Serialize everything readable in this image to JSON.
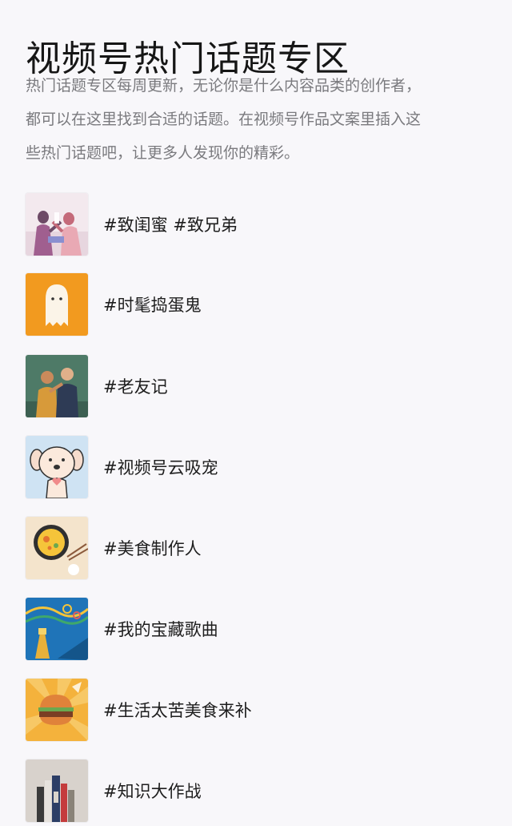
{
  "header": {
    "title": "视频号热门话题专区"
  },
  "intro": {
    "lines": [
      "热门话题专区每周更新，无论你是什么内容品类的创作者，",
      "都可以在这里找到合适的话题。在视频号作品文案里插入这",
      "些热门话题吧，让更多人发现你的精彩。"
    ]
  },
  "topics": [
    {
      "label": "#致闺蜜 #致兄弟",
      "icon": "friends-toast-illustration-icon"
    },
    {
      "label": "#时髦捣蛋鬼",
      "icon": "ghost-icon"
    },
    {
      "label": "#老友记",
      "icon": "old-friends-illustration-icon"
    },
    {
      "label": "#视频号云吸宠",
      "icon": "puppy-icon"
    },
    {
      "label": "#美食制作人",
      "icon": "food-plate-icon"
    },
    {
      "label": "#我的宝藏歌曲",
      "icon": "music-trumpet-icon"
    },
    {
      "label": "#生活太苦美食来补",
      "icon": "burger-icon"
    },
    {
      "label": "#知识大作战",
      "icon": "books-icon"
    }
  ],
  "colors": {
    "background": "#f8f7fa",
    "title": "#161616",
    "intro_text": "#7a7a7e",
    "ghost_bg": "#f29a1f",
    "music_bg": "#1f74b8"
  }
}
